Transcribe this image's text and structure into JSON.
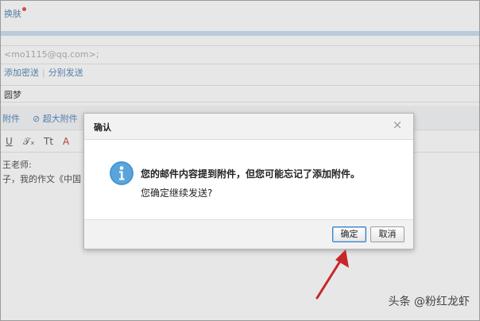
{
  "composer": {
    "skin_link": "换肤",
    "to_value": "<mo1115@qq.com>;",
    "add_cc": "添加密送",
    "separate_send": "分别发送",
    "subject_fragment": "圆梦",
    "attach_fragment": "附件",
    "super_attach": "超大附件",
    "fmt_u": "U",
    "fmt_t": "Tt",
    "fmt_a": "A",
    "body_line1": "王老师:",
    "body_line2": "子，我的作文《中国"
  },
  "dialog": {
    "title": "确认",
    "close_glyph": "×",
    "message_bold": "您的邮件内容提到附件，但您可能忘记了添加附件。",
    "message": "您确定继续发送?",
    "ok_label": "确定",
    "cancel_label": "取消"
  },
  "watermark": "头条 @粉红龙虾",
  "colors": {
    "accent": "#5aa4dc",
    "annotation_arrow": "#c8262a",
    "link": "#4a7fb5"
  }
}
